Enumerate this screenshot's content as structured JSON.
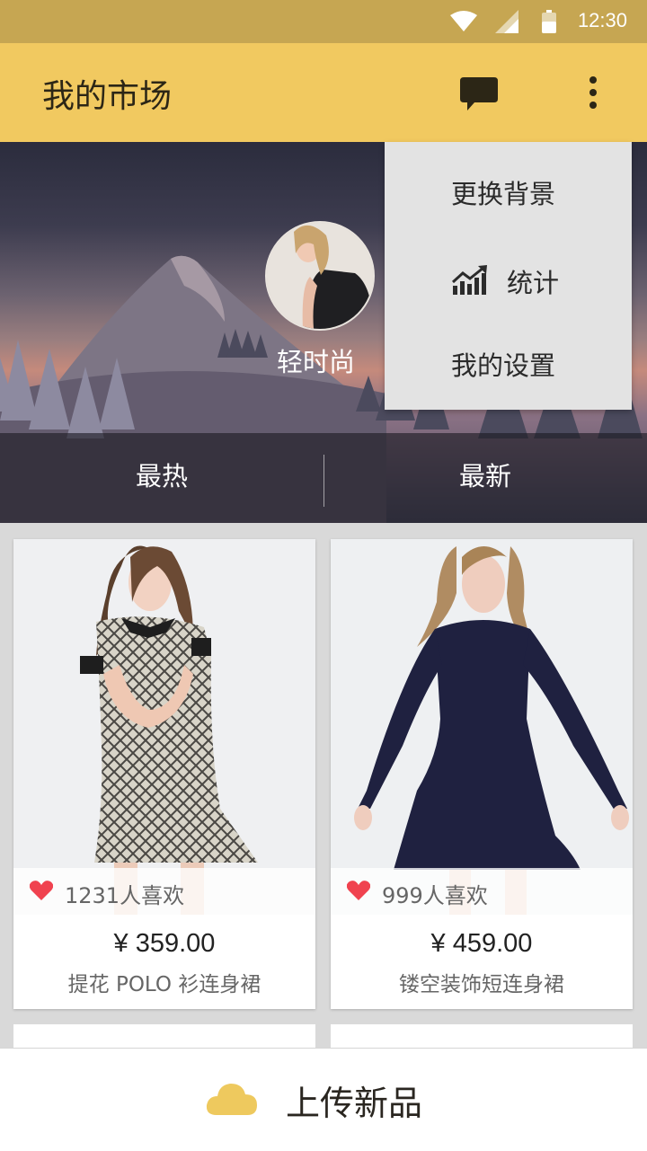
{
  "status_bar": {
    "time": "12:30",
    "icons": [
      "wifi-icon",
      "signal-icon",
      "battery-icon"
    ]
  },
  "app_bar": {
    "title": "我的市场",
    "icons": [
      "chat-bubble-icon",
      "more-vert-icon"
    ]
  },
  "profile": {
    "name": "轻时尚"
  },
  "tabs": [
    {
      "label": "最热",
      "selected": true
    },
    {
      "label": "最新",
      "selected": false
    }
  ],
  "menu": {
    "items": [
      {
        "label": "更换背景"
      },
      {
        "label": "统计",
        "icon": "stats-chart-icon"
      },
      {
        "label": "我的设置"
      }
    ]
  },
  "products": [
    {
      "likes": "1231人喜欢",
      "price": "¥ 359.00",
      "name": "提花 POLO 衫连身裙"
    },
    {
      "likes": "999人喜欢",
      "price": "¥ 459.00",
      "name": "镂空装饰短连身裙"
    }
  ],
  "bottom_action": {
    "label": "上传新品",
    "icon": "cloud-icon"
  },
  "colors": {
    "status_bar": "#c6a652",
    "app_bar": "#f1c960",
    "heart": "#f0424f",
    "cloud": "#eec95e"
  }
}
